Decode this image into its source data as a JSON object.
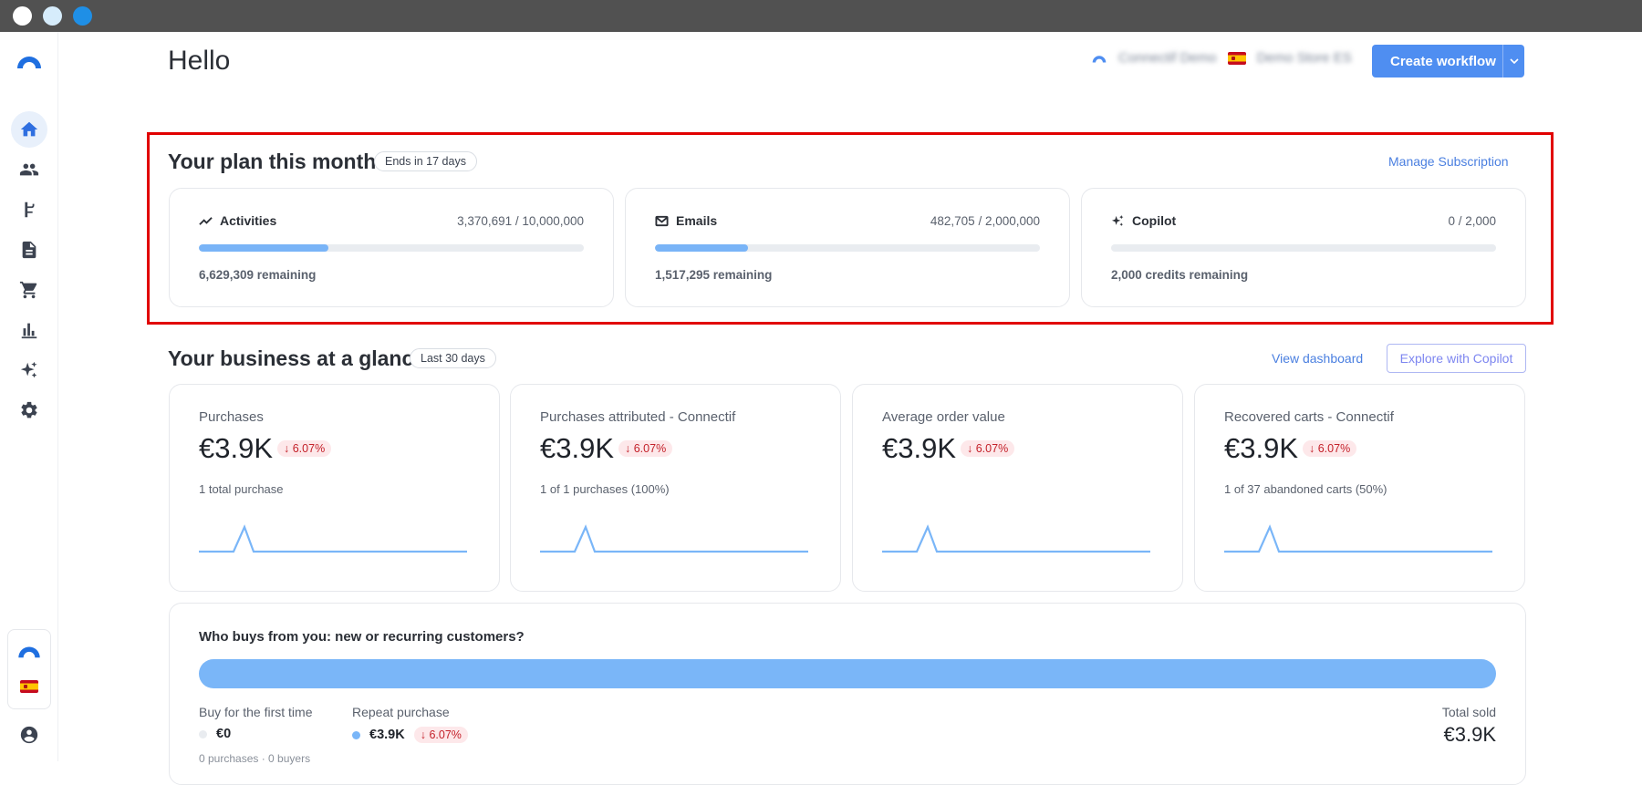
{
  "window": {
    "dots": [
      "close",
      "minimize",
      "maximize"
    ]
  },
  "sidebar": {
    "items": [
      {
        "id": "home",
        "icon": "home-icon",
        "active": true
      },
      {
        "id": "contacts",
        "icon": "people-icon",
        "active": false
      },
      {
        "id": "workflows",
        "icon": "workflow-icon",
        "active": false
      },
      {
        "id": "content",
        "icon": "document-icon",
        "active": false
      },
      {
        "id": "store",
        "icon": "cart-icon",
        "active": false
      },
      {
        "id": "reports",
        "icon": "bar-chart-icon",
        "active": false
      },
      {
        "id": "copilot",
        "icon": "sparkle-icon",
        "active": false
      },
      {
        "id": "settings",
        "icon": "gear-icon",
        "active": false
      }
    ]
  },
  "header": {
    "title": "Hello",
    "account_name": "Connectif Demo",
    "store_name": "Demo Store ES",
    "create_label": "Create workflow",
    "create_caret": "⌄"
  },
  "plan": {
    "title": "Your plan this month",
    "period_badge": "Ends in 17 days",
    "manage_label": "Manage Subscription",
    "cards": [
      {
        "name": "Activities",
        "icon": "trend-icon",
        "usage": "3,370,691 / 10,000,000",
        "fraction": 0.337,
        "remaining": "6,629,309 remaining"
      },
      {
        "name": "Emails",
        "icon": "mail-icon",
        "usage": "482,705 / 2,000,000",
        "fraction": 0.241,
        "remaining": "1,517,295 remaining"
      },
      {
        "name": "Copilot",
        "icon": "sparkle-icon",
        "usage": "0 / 2,000",
        "fraction": 0,
        "remaining": "2,000 credits remaining"
      }
    ]
  },
  "business": {
    "title": "Your business at a glance",
    "period_badge": "Last 30 days",
    "view_dashboard_label": "View dashboard",
    "explore_label": "Explore with Copilot",
    "metrics": [
      {
        "title": "Purchases",
        "value": "€3.9K",
        "change": "6.07%",
        "subtitle": "1 total purchase"
      },
      {
        "title": "Purchases attributed - Connectif",
        "value": "€3.9K",
        "change": "6.07%",
        "subtitle": "1 of 1 purchases (100%)"
      },
      {
        "title": "Average order value",
        "value": "€3.9K",
        "change": "6.07%",
        "subtitle": ""
      },
      {
        "title": "Recovered carts - Connectif",
        "value": "€3.9K",
        "change": "6.07%",
        "subtitle": "1 of 37 abandoned carts (50%)"
      }
    ],
    "change_arrow": "↓"
  },
  "buyers": {
    "title": "Who buys from you: new or recurring customers?",
    "first_time_label": "Buy for the first time",
    "first_time_value": "€0",
    "repeat_label": "Repeat purchase",
    "repeat_value": "€3.9K",
    "repeat_change": "6.07%",
    "total_label": "Total sold",
    "total_value": "€3.9K",
    "footer": "0 purchases · 0 buyers",
    "colors": {
      "first_time": "#e9ecf0",
      "repeat": "#7ab6f8"
    }
  }
}
